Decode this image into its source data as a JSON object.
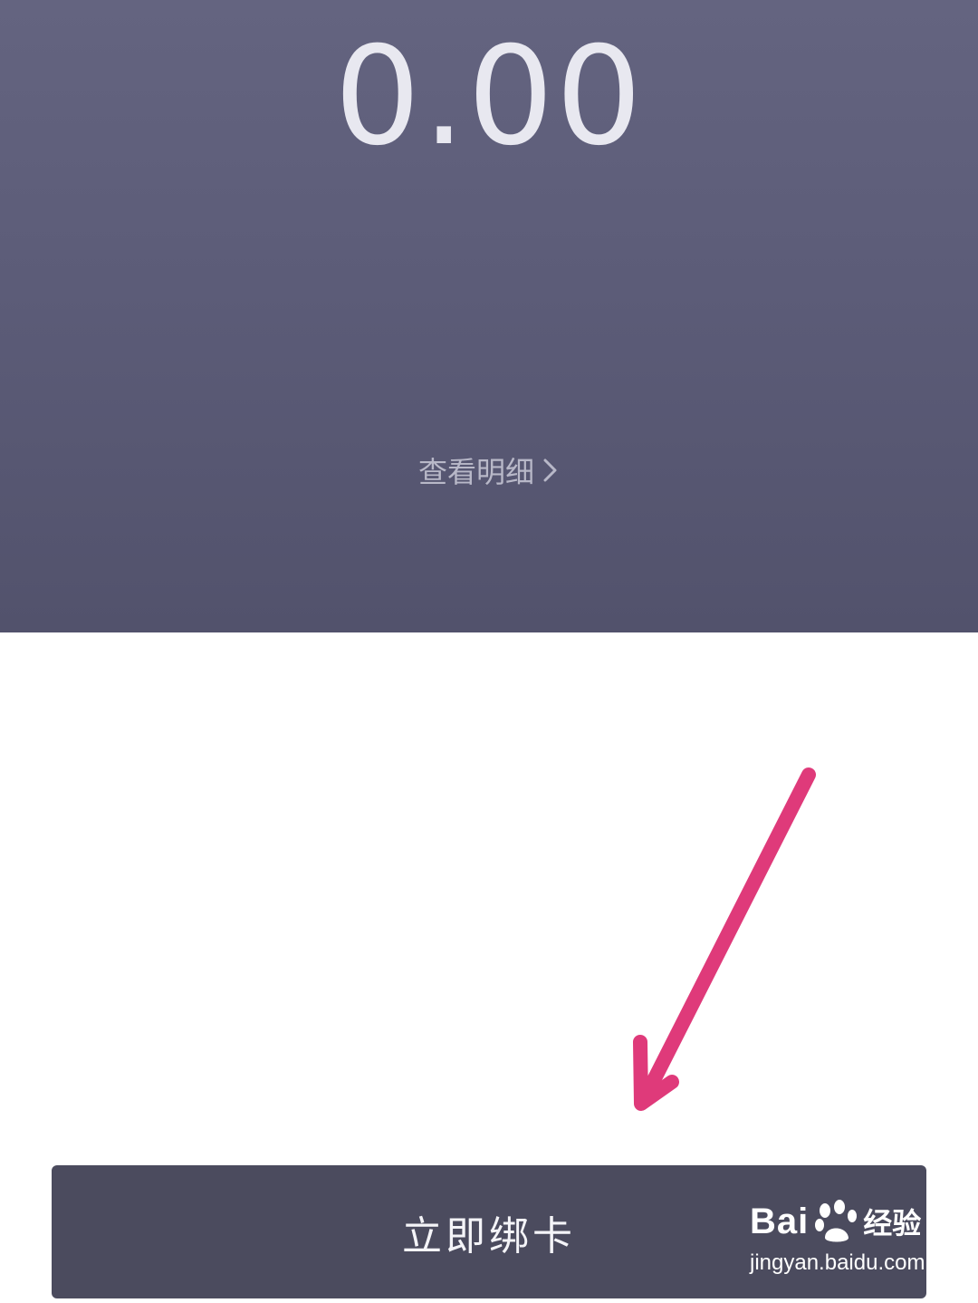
{
  "balance": {
    "amount": "0.00"
  },
  "details_link": {
    "label": "查看明细"
  },
  "bind_card_button": {
    "label": "立即绑卡"
  },
  "watermark": {
    "brand_part1": "Bai",
    "brand_part2": "经验",
    "url": "jingyan.baidu.com"
  },
  "icons": {
    "chevron": "chevron-right-icon",
    "arrow": "annotation-arrow-icon",
    "paw": "baidu-paw-icon"
  },
  "colors": {
    "header_background": "#5c5c78",
    "button_background": "#4b4b5e",
    "arrow": "#df3a7a",
    "page_background": "#ffffff"
  }
}
